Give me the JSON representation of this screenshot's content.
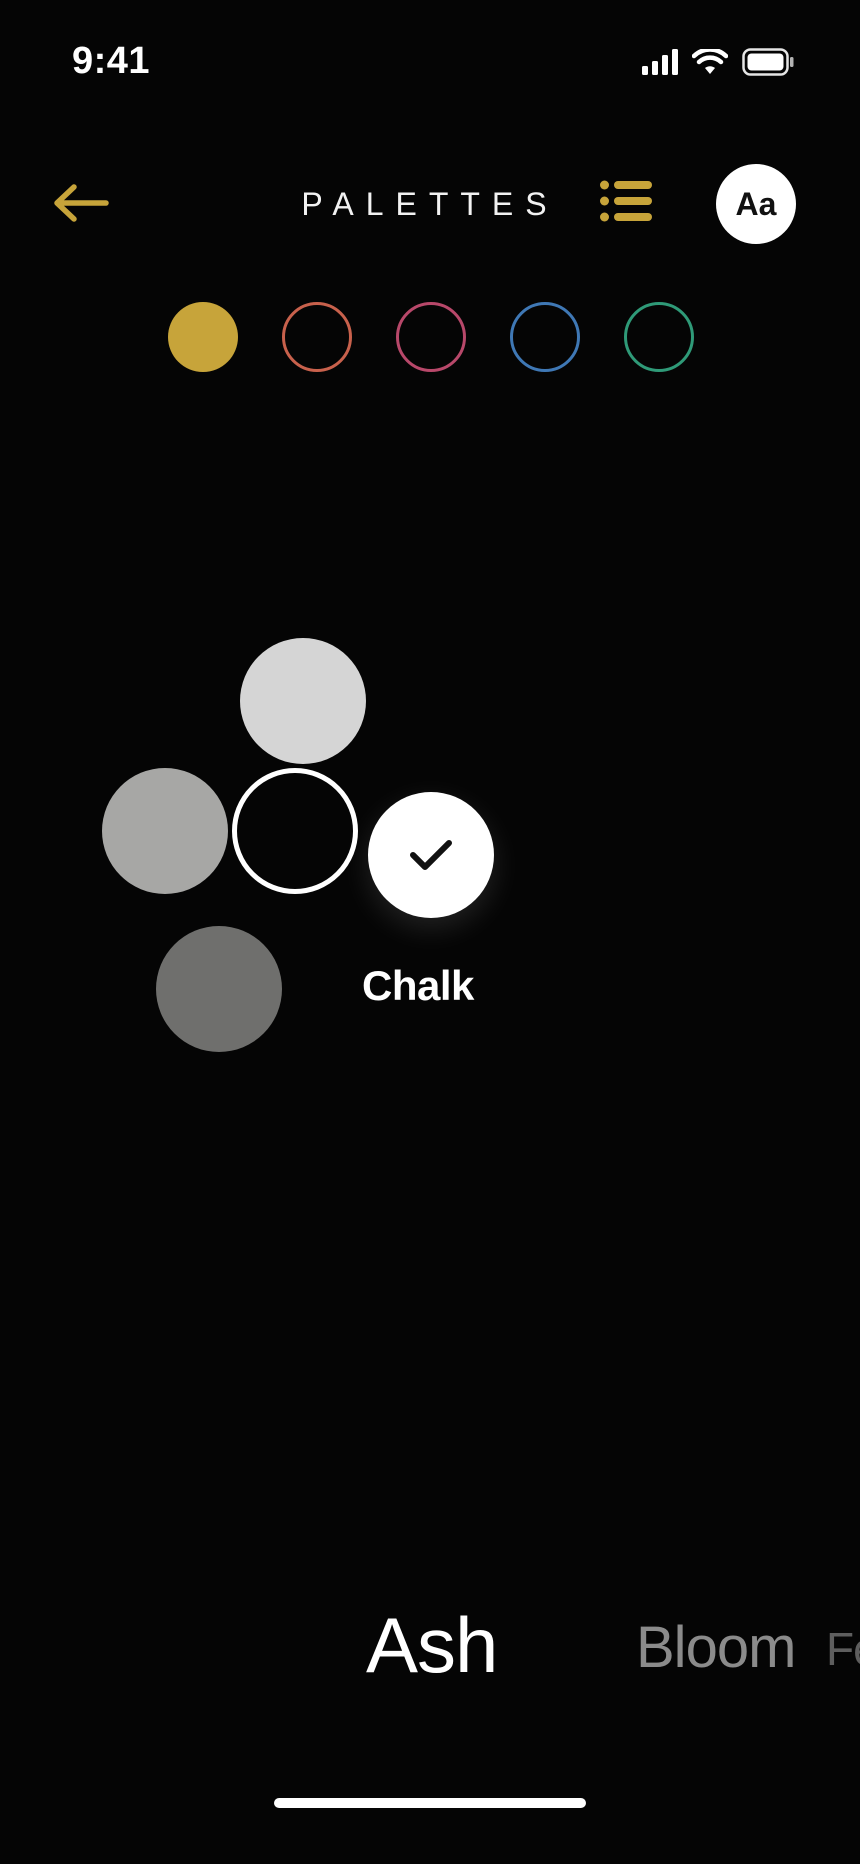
{
  "status_bar": {
    "time": "9:41"
  },
  "header": {
    "title": "PALETTES",
    "font_button_label": "Aa"
  },
  "colors": {
    "accent": "#C7A43A"
  },
  "palette_dots": [
    {
      "name": "gold",
      "color": "#C7A43A",
      "selected": true
    },
    {
      "name": "coral",
      "color": "#C8614C",
      "selected": false
    },
    {
      "name": "rose",
      "color": "#B8486A",
      "selected": false
    },
    {
      "name": "blue",
      "color": "#3F78B5",
      "selected": false
    },
    {
      "name": "teal",
      "color": "#2F9A78",
      "selected": false
    }
  ],
  "swatches": {
    "selected_label": "Chalk",
    "items": [
      {
        "name": "light-gray",
        "color": "#D5D5D5"
      },
      {
        "name": "silver",
        "color": "#A7A7A5"
      },
      {
        "name": "black-outline",
        "color": "#050505"
      },
      {
        "name": "chalk",
        "color": "#FFFFFF",
        "selected": true
      },
      {
        "name": "dark-gray",
        "color": "#6F6F6D"
      }
    ]
  },
  "palette_names": {
    "current": "Ash",
    "next": "Bloom",
    "partial": "Fe"
  }
}
